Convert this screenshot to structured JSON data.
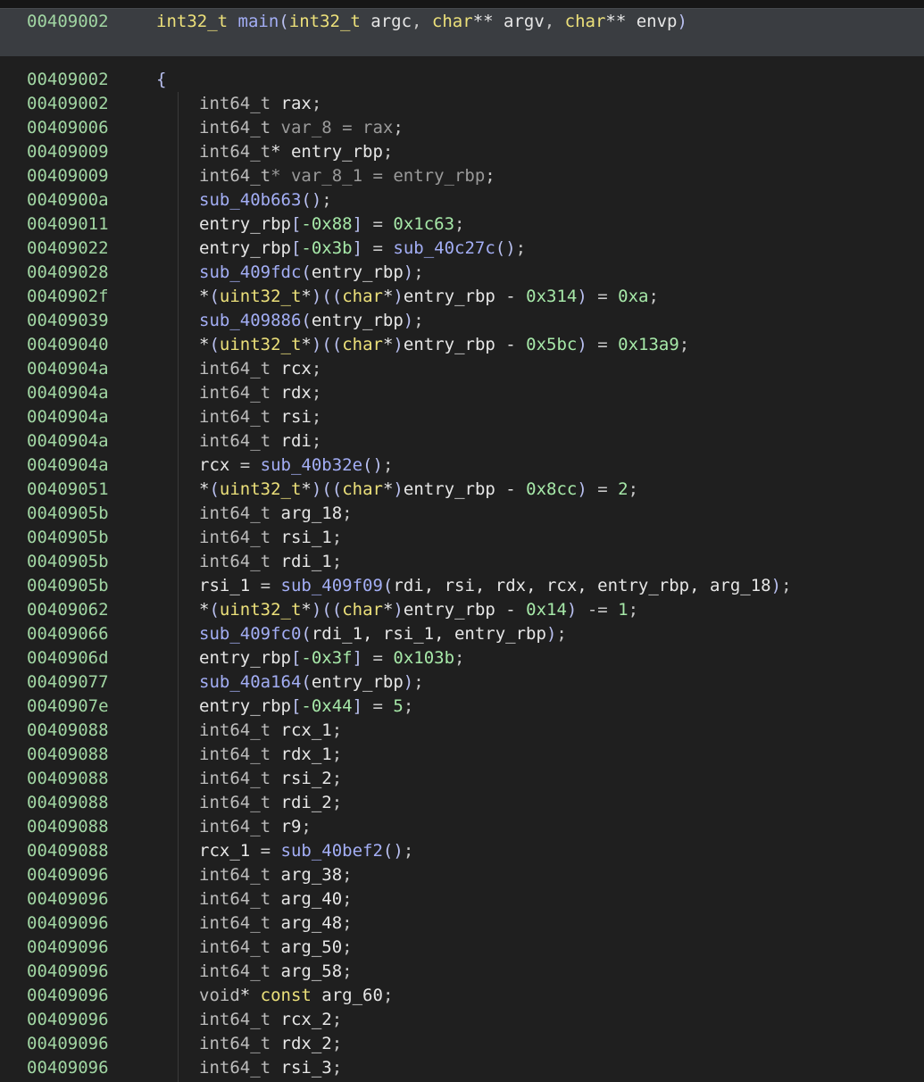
{
  "header": {
    "address": "00409002",
    "tokens": [
      [
        "type",
        "int32_t"
      ],
      [
        "punc",
        " "
      ],
      [
        "func",
        "main"
      ],
      [
        "paren",
        "("
      ],
      [
        "type",
        "int32_t"
      ],
      [
        "var",
        " argc"
      ],
      [
        "punc",
        ", "
      ],
      [
        "type",
        "char"
      ],
      [
        "var",
        "** argv"
      ],
      [
        "punc",
        ", "
      ],
      [
        "type",
        "char"
      ],
      [
        "var",
        "** envp"
      ],
      [
        "paren",
        ")"
      ]
    ]
  },
  "lines": [
    {
      "address": "00409002",
      "indent": 0,
      "tokens": [
        [
          "paren",
          "{"
        ]
      ]
    },
    {
      "address": "00409002",
      "indent": 1,
      "tokens": [
        [
          "ctype",
          "int64_t"
        ],
        [
          "var",
          " rax"
        ],
        [
          "punc",
          ";"
        ]
      ]
    },
    {
      "address": "00409006",
      "indent": 1,
      "tokens": [
        [
          "ctype",
          "int64_t"
        ],
        [
          "dim",
          " var_8 = rax"
        ],
        [
          "punc",
          ";"
        ]
      ]
    },
    {
      "address": "00409009",
      "indent": 1,
      "tokens": [
        [
          "ctype",
          "int64_t"
        ],
        [
          "var",
          "* entry_rbp"
        ],
        [
          "punc",
          ";"
        ]
      ]
    },
    {
      "address": "00409009",
      "indent": 1,
      "tokens": [
        [
          "ctype",
          "int64_t"
        ],
        [
          "dim",
          "* var_8_1 = entry_rbp"
        ],
        [
          "punc",
          ";"
        ]
      ]
    },
    {
      "address": "0040900a",
      "indent": 1,
      "tokens": [
        [
          "func",
          "sub_40b663"
        ],
        [
          "paren",
          "()"
        ],
        [
          "punc",
          ";"
        ]
      ]
    },
    {
      "address": "00409011",
      "indent": 1,
      "tokens": [
        [
          "var",
          "entry_rbp"
        ],
        [
          "paren",
          "["
        ],
        [
          "num",
          "-0x88"
        ],
        [
          "paren",
          "]"
        ],
        [
          "punc",
          " = "
        ],
        [
          "num",
          "0x1c63"
        ],
        [
          "punc",
          ";"
        ]
      ]
    },
    {
      "address": "00409022",
      "indent": 1,
      "tokens": [
        [
          "var",
          "entry_rbp"
        ],
        [
          "paren",
          "["
        ],
        [
          "num",
          "-0x3b"
        ],
        [
          "paren",
          "]"
        ],
        [
          "punc",
          " = "
        ],
        [
          "func",
          "sub_40c27c"
        ],
        [
          "paren",
          "()"
        ],
        [
          "punc",
          ";"
        ]
      ]
    },
    {
      "address": "00409028",
      "indent": 1,
      "tokens": [
        [
          "func",
          "sub_409fdc"
        ],
        [
          "paren",
          "("
        ],
        [
          "var",
          "entry_rbp"
        ],
        [
          "paren",
          ")"
        ],
        [
          "punc",
          ";"
        ]
      ]
    },
    {
      "address": "0040902f",
      "indent": 1,
      "tokens": [
        [
          "var",
          "*"
        ],
        [
          "paren",
          "("
        ],
        [
          "type",
          "uint32_t"
        ],
        [
          "var",
          "*"
        ],
        [
          "paren",
          ")(("
        ],
        [
          "type",
          "char"
        ],
        [
          "var",
          "*"
        ],
        [
          "paren",
          ")"
        ],
        [
          "var",
          "entry_rbp - "
        ],
        [
          "num",
          "0x314"
        ],
        [
          "paren",
          ")"
        ],
        [
          "punc",
          " = "
        ],
        [
          "num",
          "0xa"
        ],
        [
          "punc",
          ";"
        ]
      ]
    },
    {
      "address": "00409039",
      "indent": 1,
      "tokens": [
        [
          "func",
          "sub_409886"
        ],
        [
          "paren",
          "("
        ],
        [
          "var",
          "entry_rbp"
        ],
        [
          "paren",
          ")"
        ],
        [
          "punc",
          ";"
        ]
      ]
    },
    {
      "address": "00409040",
      "indent": 1,
      "tokens": [
        [
          "var",
          "*"
        ],
        [
          "paren",
          "("
        ],
        [
          "type",
          "uint32_t"
        ],
        [
          "var",
          "*"
        ],
        [
          "paren",
          ")(("
        ],
        [
          "type",
          "char"
        ],
        [
          "var",
          "*"
        ],
        [
          "paren",
          ")"
        ],
        [
          "var",
          "entry_rbp - "
        ],
        [
          "num",
          "0x5bc"
        ],
        [
          "paren",
          ")"
        ],
        [
          "punc",
          " = "
        ],
        [
          "num",
          "0x13a9"
        ],
        [
          "punc",
          ";"
        ]
      ]
    },
    {
      "address": "0040904a",
      "indent": 1,
      "tokens": [
        [
          "ctype",
          "int64_t"
        ],
        [
          "var",
          " rcx"
        ],
        [
          "punc",
          ";"
        ]
      ]
    },
    {
      "address": "0040904a",
      "indent": 1,
      "tokens": [
        [
          "ctype",
          "int64_t"
        ],
        [
          "var",
          " rdx"
        ],
        [
          "punc",
          ";"
        ]
      ]
    },
    {
      "address": "0040904a",
      "indent": 1,
      "tokens": [
        [
          "ctype",
          "int64_t"
        ],
        [
          "var",
          " rsi"
        ],
        [
          "punc",
          ";"
        ]
      ]
    },
    {
      "address": "0040904a",
      "indent": 1,
      "tokens": [
        [
          "ctype",
          "int64_t"
        ],
        [
          "var",
          " rdi"
        ],
        [
          "punc",
          ";"
        ]
      ]
    },
    {
      "address": "0040904a",
      "indent": 1,
      "tokens": [
        [
          "var",
          "rcx"
        ],
        [
          "punc",
          " = "
        ],
        [
          "func",
          "sub_40b32e"
        ],
        [
          "paren",
          "()"
        ],
        [
          "punc",
          ";"
        ]
      ]
    },
    {
      "address": "00409051",
      "indent": 1,
      "tokens": [
        [
          "var",
          "*"
        ],
        [
          "paren",
          "("
        ],
        [
          "type",
          "uint32_t"
        ],
        [
          "var",
          "*"
        ],
        [
          "paren",
          ")(("
        ],
        [
          "type",
          "char"
        ],
        [
          "var",
          "*"
        ],
        [
          "paren",
          ")"
        ],
        [
          "var",
          "entry_rbp - "
        ],
        [
          "num",
          "0x8cc"
        ],
        [
          "paren",
          ")"
        ],
        [
          "punc",
          " = "
        ],
        [
          "num",
          "2"
        ],
        [
          "punc",
          ";"
        ]
      ]
    },
    {
      "address": "0040905b",
      "indent": 1,
      "tokens": [
        [
          "ctype",
          "int64_t"
        ],
        [
          "var",
          " arg_18"
        ],
        [
          "punc",
          ";"
        ]
      ]
    },
    {
      "address": "0040905b",
      "indent": 1,
      "tokens": [
        [
          "ctype",
          "int64_t"
        ],
        [
          "var",
          " rsi_1"
        ],
        [
          "punc",
          ";"
        ]
      ]
    },
    {
      "address": "0040905b",
      "indent": 1,
      "tokens": [
        [
          "ctype",
          "int64_t"
        ],
        [
          "var",
          " rdi_1"
        ],
        [
          "punc",
          ";"
        ]
      ]
    },
    {
      "address": "0040905b",
      "indent": 1,
      "tokens": [
        [
          "var",
          "rsi_1"
        ],
        [
          "punc",
          " = "
        ],
        [
          "func",
          "sub_409f09"
        ],
        [
          "paren",
          "("
        ],
        [
          "var",
          "rdi, rsi, rdx, rcx, entry_rbp, arg_18"
        ],
        [
          "paren",
          ")"
        ],
        [
          "punc",
          ";"
        ]
      ]
    },
    {
      "address": "00409062",
      "indent": 1,
      "tokens": [
        [
          "var",
          "*"
        ],
        [
          "paren",
          "("
        ],
        [
          "type",
          "uint32_t"
        ],
        [
          "var",
          "*"
        ],
        [
          "paren",
          ")(("
        ],
        [
          "type",
          "char"
        ],
        [
          "var",
          "*"
        ],
        [
          "paren",
          ")"
        ],
        [
          "var",
          "entry_rbp - "
        ],
        [
          "num",
          "0x14"
        ],
        [
          "paren",
          ")"
        ],
        [
          "punc",
          " -= "
        ],
        [
          "num",
          "1"
        ],
        [
          "punc",
          ";"
        ]
      ]
    },
    {
      "address": "00409066",
      "indent": 1,
      "tokens": [
        [
          "func",
          "sub_409fc0"
        ],
        [
          "paren",
          "("
        ],
        [
          "var",
          "rdi_1, rsi_1, entry_rbp"
        ],
        [
          "paren",
          ")"
        ],
        [
          "punc",
          ";"
        ]
      ]
    },
    {
      "address": "0040906d",
      "indent": 1,
      "tokens": [
        [
          "var",
          "entry_rbp"
        ],
        [
          "paren",
          "["
        ],
        [
          "num",
          "-0x3f"
        ],
        [
          "paren",
          "]"
        ],
        [
          "punc",
          " = "
        ],
        [
          "num",
          "0x103b"
        ],
        [
          "punc",
          ";"
        ]
      ]
    },
    {
      "address": "00409077",
      "indent": 1,
      "tokens": [
        [
          "func",
          "sub_40a164"
        ],
        [
          "paren",
          "("
        ],
        [
          "var",
          "entry_rbp"
        ],
        [
          "paren",
          ")"
        ],
        [
          "punc",
          ";"
        ]
      ]
    },
    {
      "address": "0040907e",
      "indent": 1,
      "tokens": [
        [
          "var",
          "entry_rbp"
        ],
        [
          "paren",
          "["
        ],
        [
          "num",
          "-0x44"
        ],
        [
          "paren",
          "]"
        ],
        [
          "punc",
          " = "
        ],
        [
          "num",
          "5"
        ],
        [
          "punc",
          ";"
        ]
      ]
    },
    {
      "address": "00409088",
      "indent": 1,
      "tokens": [
        [
          "ctype",
          "int64_t"
        ],
        [
          "var",
          " rcx_1"
        ],
        [
          "punc",
          ";"
        ]
      ]
    },
    {
      "address": "00409088",
      "indent": 1,
      "tokens": [
        [
          "ctype",
          "int64_t"
        ],
        [
          "var",
          " rdx_1"
        ],
        [
          "punc",
          ";"
        ]
      ]
    },
    {
      "address": "00409088",
      "indent": 1,
      "tokens": [
        [
          "ctype",
          "int64_t"
        ],
        [
          "var",
          " rsi_2"
        ],
        [
          "punc",
          ";"
        ]
      ]
    },
    {
      "address": "00409088",
      "indent": 1,
      "tokens": [
        [
          "ctype",
          "int64_t"
        ],
        [
          "var",
          " rdi_2"
        ],
        [
          "punc",
          ";"
        ]
      ]
    },
    {
      "address": "00409088",
      "indent": 1,
      "tokens": [
        [
          "ctype",
          "int64_t"
        ],
        [
          "var",
          " r9"
        ],
        [
          "punc",
          ";"
        ]
      ]
    },
    {
      "address": "00409088",
      "indent": 1,
      "tokens": [
        [
          "var",
          "rcx_1"
        ],
        [
          "punc",
          " = "
        ],
        [
          "func",
          "sub_40bef2"
        ],
        [
          "paren",
          "()"
        ],
        [
          "punc",
          ";"
        ]
      ]
    },
    {
      "address": "00409096",
      "indent": 1,
      "tokens": [
        [
          "ctype",
          "int64_t"
        ],
        [
          "var",
          " arg_38"
        ],
        [
          "punc",
          ";"
        ]
      ]
    },
    {
      "address": "00409096",
      "indent": 1,
      "tokens": [
        [
          "ctype",
          "int64_t"
        ],
        [
          "var",
          " arg_40"
        ],
        [
          "punc",
          ";"
        ]
      ]
    },
    {
      "address": "00409096",
      "indent": 1,
      "tokens": [
        [
          "ctype",
          "int64_t"
        ],
        [
          "var",
          " arg_48"
        ],
        [
          "punc",
          ";"
        ]
      ]
    },
    {
      "address": "00409096",
      "indent": 1,
      "tokens": [
        [
          "ctype",
          "int64_t"
        ],
        [
          "var",
          " arg_50"
        ],
        [
          "punc",
          ";"
        ]
      ]
    },
    {
      "address": "00409096",
      "indent": 1,
      "tokens": [
        [
          "ctype",
          "int64_t"
        ],
        [
          "var",
          " arg_58"
        ],
        [
          "punc",
          ";"
        ]
      ]
    },
    {
      "address": "00409096",
      "indent": 1,
      "tokens": [
        [
          "ctype",
          "void"
        ],
        [
          "var",
          "* "
        ],
        [
          "type",
          "const"
        ],
        [
          "var",
          " arg_60"
        ],
        [
          "punc",
          ";"
        ]
      ]
    },
    {
      "address": "00409096",
      "indent": 1,
      "tokens": [
        [
          "ctype",
          "int64_t"
        ],
        [
          "var",
          " rcx_2"
        ],
        [
          "punc",
          ";"
        ]
      ]
    },
    {
      "address": "00409096",
      "indent": 1,
      "tokens": [
        [
          "ctype",
          "int64_t"
        ],
        [
          "var",
          " rdx_2"
        ],
        [
          "punc",
          ";"
        ]
      ]
    },
    {
      "address": "00409096",
      "indent": 1,
      "tokens": [
        [
          "ctype",
          "int64_t"
        ],
        [
          "var",
          " rsi_3"
        ],
        [
          "punc",
          ";"
        ]
      ]
    }
  ]
}
